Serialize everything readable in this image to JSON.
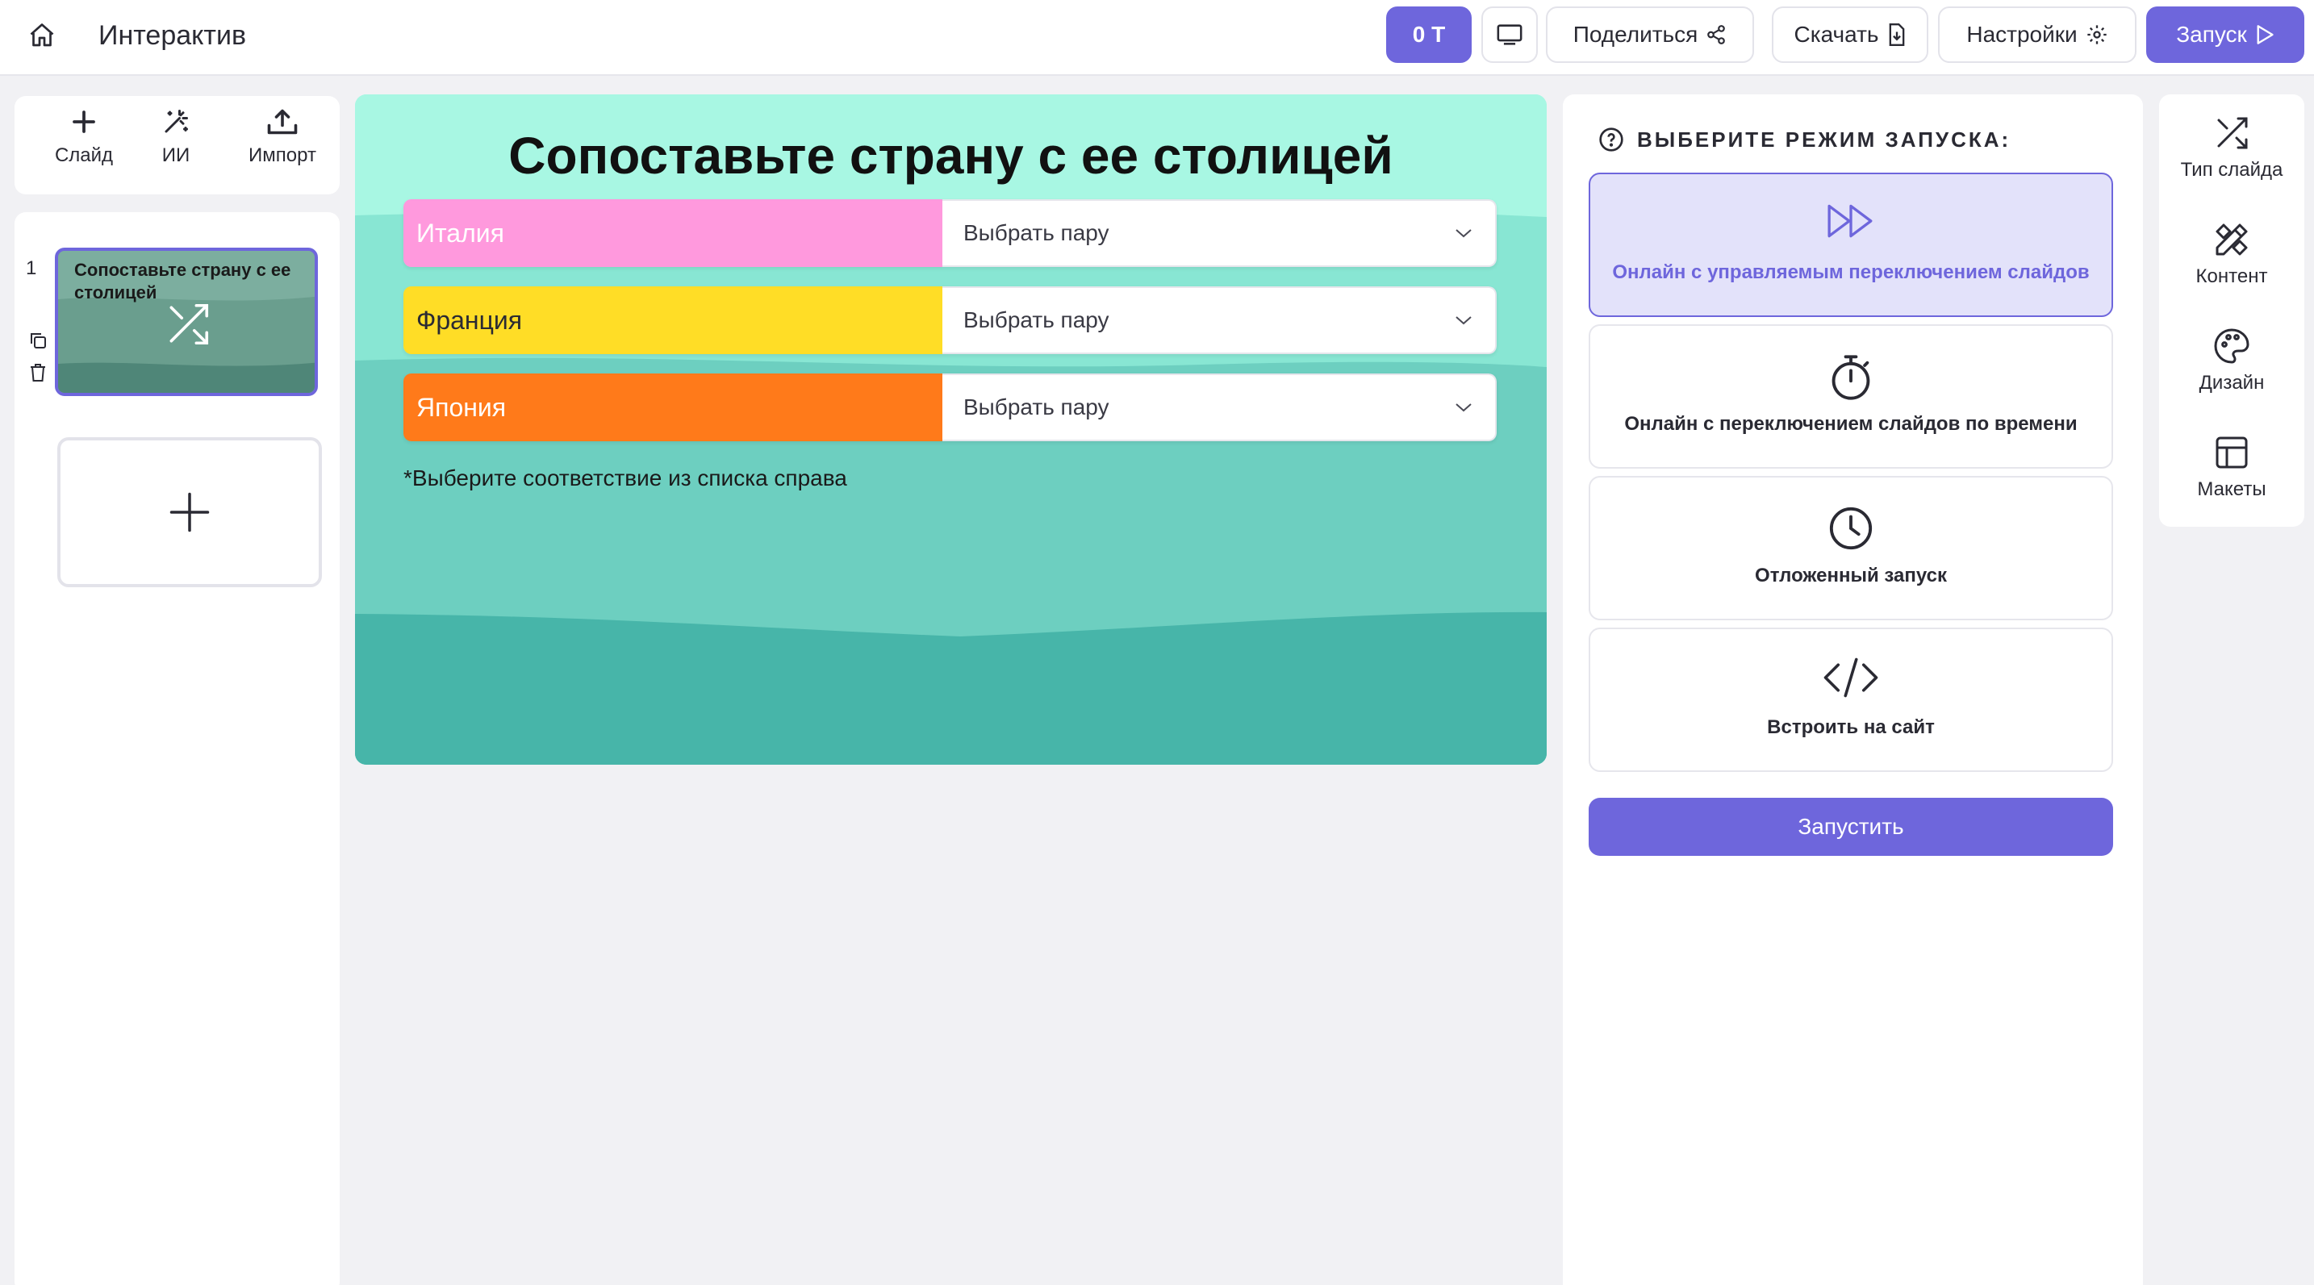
{
  "header": {
    "app_title": "Интерактив",
    "tokens_label": "0 T",
    "share_label": "Поделиться",
    "download_label": "Скачать",
    "settings_label": "Настройки",
    "launch_label": "Запуск"
  },
  "left_toolbar": {
    "items": [
      {
        "label": "Слайд",
        "icon": "plus-icon"
      },
      {
        "label": "ИИ",
        "icon": "magic-wand-icon"
      },
      {
        "label": "Импорт",
        "icon": "upload-icon"
      }
    ]
  },
  "slides": [
    {
      "number": "1",
      "title": "Сопоставьте страну с ее столицей"
    }
  ],
  "canvas": {
    "title": "Сопоставьте страну с ее столицей",
    "rows": [
      {
        "country": "Италия",
        "placeholder": "Выбрать пару",
        "color": "#ff99dd",
        "text_color": "#ffffff"
      },
      {
        "country": "Франция",
        "placeholder": "Выбрать пару",
        "color": "#ffdd26",
        "text_color": "#2a2a33"
      },
      {
        "country": "Япония",
        "placeholder": "Выбрать пару",
        "color": "#ff7a1a",
        "text_color": "#ffffff"
      }
    ],
    "note": "*Выберите соответствие из списка справа"
  },
  "launch_panel": {
    "heading": "ВЫБЕРИТЕ РЕЖИМ ЗАПУСКА:",
    "modes": [
      {
        "label": "Онлайн с управляемым переключением слайдов",
        "icon": "fast-forward-icon",
        "active": true
      },
      {
        "label": "Онлайн с переключением слайдов по времени",
        "icon": "stopwatch-icon",
        "active": false
      },
      {
        "label": "Отложенный запуск",
        "icon": "clock-icon",
        "active": false
      },
      {
        "label": "Встроить на сайт",
        "icon": "code-icon",
        "active": false
      }
    ],
    "run_label": "Запустить"
  },
  "right_toolbar": {
    "items": [
      {
        "label": "Тип слайда",
        "icon": "shuffle-icon"
      },
      {
        "label": "Контент",
        "icon": "pencil-ruler-icon"
      },
      {
        "label": "Дизайн",
        "icon": "palette-icon"
      },
      {
        "label": "Макеты",
        "icon": "layout-icon"
      }
    ]
  },
  "colors": {
    "accent": "#6e66dc",
    "active_card_bg": "#e3e2fa",
    "canvas_light": "#a8f7e3",
    "canvas_mid": "#6dcfc0",
    "canvas_dark": "#47b5a9"
  }
}
